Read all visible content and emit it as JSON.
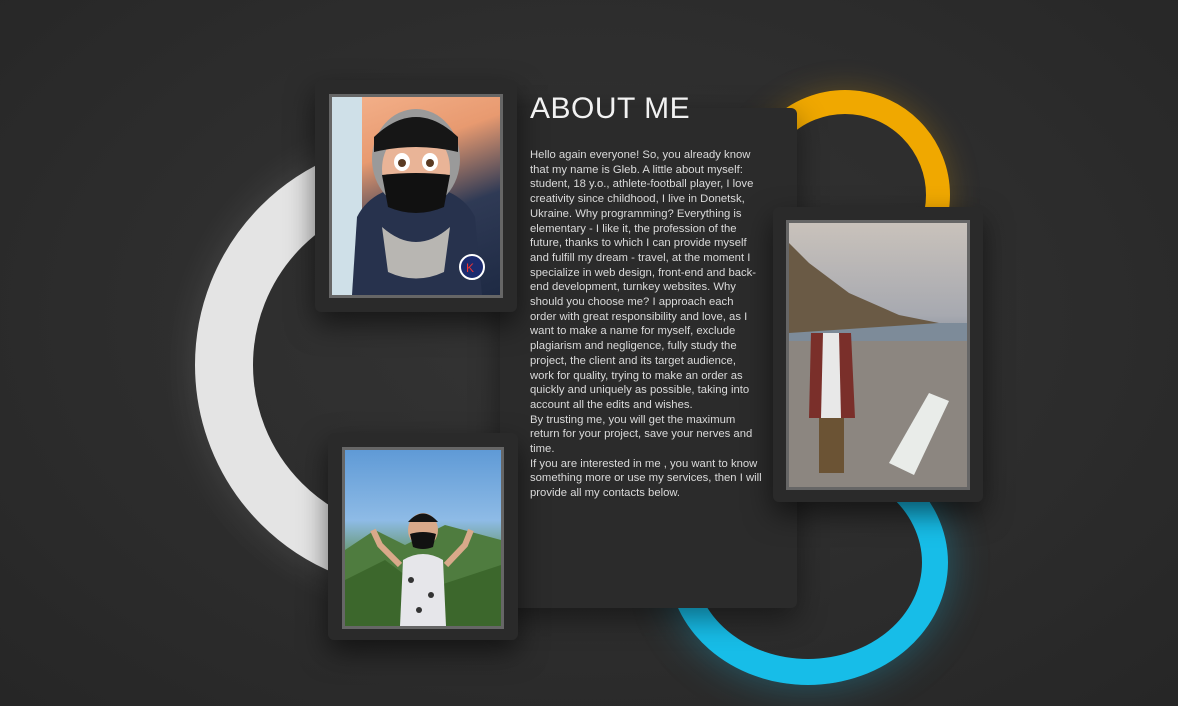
{
  "about": {
    "title": "ABOUT ME",
    "paragraphs": [
      "Hello again everyone! So, you already know that my name is Gleb. A little about myself: student, 18 y.o., athlete-football player, I love creativity since childhood, I live in Donetsk, Ukraine. Why programming? Everything is elementary - I like it, the profession of the future, thanks to which I can provide myself and fulfill my dream - travel, at the moment I specialize in web design, front-end and back-end development, turnkey websites. Why should you choose me? I approach each order with great responsibility and love, as I want to make a name for myself, exclude plagiarism and negligence, fully study the project, the client and its target audience, work for quality, trying to make an order as quickly and uniquely as possible, taking into account all the edits and wishes.",
      "By trusting me, you will get the maximum return for your project, save your nerves and time.",
      "If you are interested in me , you want to know something more or use my services, then I will provide all my contacts below."
    ]
  },
  "colors": {
    "ring_white": "#e4e4e4",
    "ring_yellow": "#f0a800",
    "ring_blue": "#17bde8",
    "background": "#2d2d2d"
  }
}
